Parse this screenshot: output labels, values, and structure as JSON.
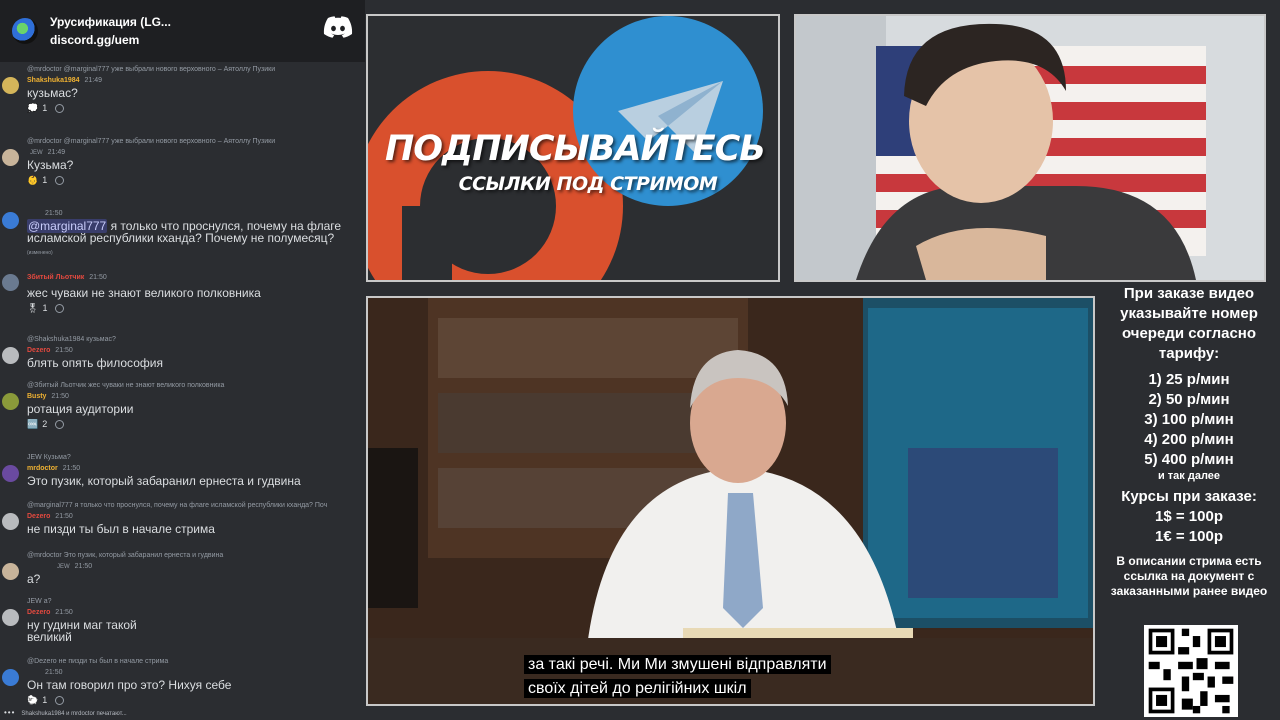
{
  "chat": {
    "header": {
      "server_name": "Урусификация (LG...",
      "invite": "discord.gg/uem"
    },
    "messages": [
      {
        "reply": "@mrdoctor @marginal777 уже выбрали нового верховного – Аятоллу Пузики",
        "name": "Shakshuka1984",
        "name_color": "#f0b232",
        "time": "21:49",
        "text": "кузьмас?",
        "reaction_count": "1",
        "avatar_color": "#d4b55a"
      },
      {
        "reply": "@mrdoctor @marginal777 уже выбрали нового верховного – Аятоллу Пузики",
        "name": "",
        "tag": "JEW",
        "name_color": "#dbdee1",
        "time": "21:49",
        "text": "Кузьма?",
        "reaction_count": "1",
        "avatar_color": "#c8b49a"
      },
      {
        "reply": "",
        "name": "",
        "name_color": "#dbdee1",
        "time": "21:50",
        "mention": "@marginal777",
        "text": "я только что проснулся, почему на флаге исламской республики кханда? Почему не полумесяц?",
        "edited": "(изменено)",
        "avatar_color": "#3a7bd5"
      },
      {
        "reply": "",
        "name": "Збитый Льотчик",
        "name_color": "#e3493f",
        "time": "21:50",
        "text": "жес чуваки не знают великого полковника",
        "reaction_count": "1",
        "avatar_color": "#6a7a90"
      },
      {
        "reply": "@Shakshuka1984 кузьмас?",
        "name": "Dezero",
        "name_color": "#e3493f",
        "time": "21:50",
        "text": "блять опять философия",
        "avatar_color": "#b9bbbe"
      },
      {
        "reply": "@Збитый Льотчик жес чуваки не знают великого полковника",
        "name": "Busty",
        "name_color": "#f0b232",
        "time": "21:50",
        "text": "ротация аудитории",
        "reaction_count": "2",
        "avatar_color": "#8a9a3a"
      },
      {
        "reply": "JEW Кузьма?",
        "name": "mrdoctor",
        "name_color": "#f0b232",
        "time": "21:50",
        "text": "Это пузик, который забаранил ернеста и гудвина",
        "avatar_color": "#6a4aa0"
      },
      {
        "reply": "@marginal777 я только что проснулся, почему на флаге исламской республики кханда? Поч",
        "name": "Dezero",
        "name_color": "#e3493f",
        "time": "21:50",
        "text": "не пизди ты был в начале стрима",
        "avatar_color": "#b9bbbe"
      },
      {
        "reply": "@mrdoctor Это пузик, который забаранил ернеста и гудвина",
        "name": "",
        "tag": "JEW",
        "name_color": "#dbdee1",
        "time": "21:50",
        "text": "а?",
        "avatar_color": "#c8b49a"
      },
      {
        "reply": "JEW а?",
        "name": "Dezero",
        "name_color": "#e3493f",
        "time": "21:50",
        "text": "ну гудини маг такой великий",
        "avatar_color": "#b9bbbe"
      },
      {
        "reply": "@Dezero не пизди ты был в начале стрима",
        "name": "",
        "name_color": "#dbdee1",
        "time": "21:50",
        "text": "Он там говорил про это? Нихуя себе",
        "reaction_count": "1",
        "avatar_color": "#3a7bd5"
      }
    ],
    "typing": "Shakshuka1984 и mrdoctor печатают..."
  },
  "promo": {
    "title": "ПОДПИСЫВАЙТЕСЬ",
    "subtitle": "ССЫЛКИ ПОД СТРИМОМ",
    "patreon_color": "#d9502d",
    "telegram_color": "#2f8fd0"
  },
  "video": {
    "subtitle_line1": "за такі речі. Ми  Ми змушені відправляти",
    "subtitle_line2": "своїх дітей до релігійних шкіл"
  },
  "info": {
    "heading": "При заказе видео указывайте номер очереди согласно тарифу:",
    "prices": [
      "1) 25 р/мин",
      "2) 50 р/мин",
      "3) 100 р/мин",
      "4) 200 р/мин",
      "5) 400 р/мин"
    ],
    "and_more": "и так далее",
    "courses_heading": "Курсы при заказе:",
    "courses": [
      "1$ = 100р",
      "1€ = 100р"
    ],
    "note": "В описании стрима есть ссылка на документ с заказанными ранее видео"
  }
}
